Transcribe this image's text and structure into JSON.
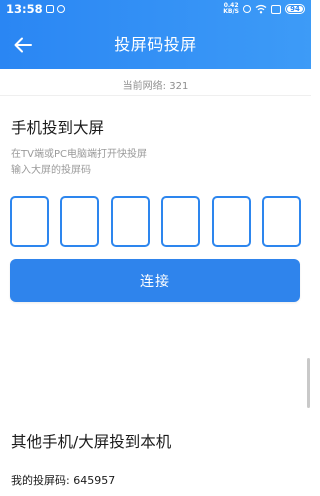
{
  "status_bar": {
    "time": "13:58",
    "net_speed_value": "0.42",
    "net_speed_unit": "KB/S",
    "battery": "94"
  },
  "header": {
    "title": "投屏码投屏"
  },
  "network": {
    "label": "当前网络: ",
    "value": "321"
  },
  "phone_section": {
    "title": "手机投到大屏",
    "hint_line1": "在TV端或PC电脑端打开快投屏",
    "hint_line2": "输入大屏的投屏码"
  },
  "code_input": {
    "digits": [
      "",
      "",
      "",
      "",
      "",
      ""
    ]
  },
  "connect_button": {
    "label": "连接"
  },
  "other_section": {
    "title": "其他手机/大屏投到本机",
    "my_code_label": "我的投屏码: ",
    "my_code_value": "645957"
  },
  "colors": {
    "header_gradient_start": "#2a86f3",
    "header_gradient_end": "#3d9bf7",
    "accent": "#2f84ec"
  }
}
